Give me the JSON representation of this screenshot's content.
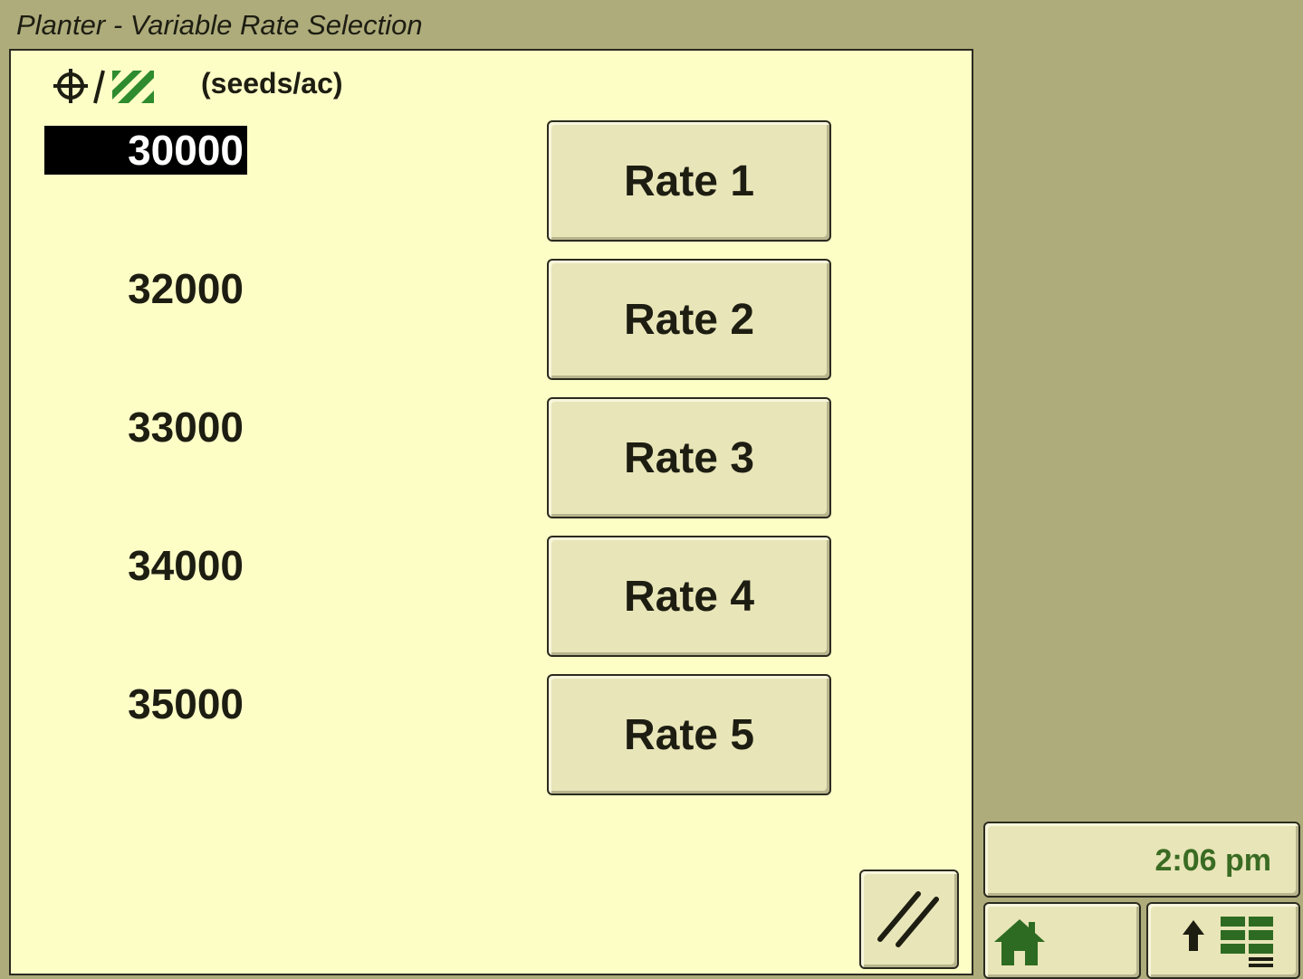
{
  "window": {
    "title": "Planter - Variable Rate Selection"
  },
  "header": {
    "icon": "target-crosshair-hatch-icon",
    "unit_label": "(seeds/ac)"
  },
  "rates": [
    {
      "value": "30000",
      "button_label": "Rate 1",
      "selected": true
    },
    {
      "value": "32000",
      "button_label": "Rate 2",
      "selected": false
    },
    {
      "value": "33000",
      "button_label": "Rate 3",
      "selected": false
    },
    {
      "value": "34000",
      "button_label": "Rate 4",
      "selected": false
    },
    {
      "value": "35000",
      "button_label": "Rate 5",
      "selected": false
    }
  ],
  "status": {
    "time": "2:06 pm"
  },
  "buttons": {
    "slash_icon": "double-slash-icon",
    "home_icon": "home-icon",
    "layout_icon": "layout-up-icon"
  },
  "colors": {
    "panel_background": "#fdfdc6",
    "frame_background": "#aeac7b",
    "button_face": "#e8e5b8",
    "accent_green": "#3a6b23",
    "selected_background": "#000000"
  }
}
